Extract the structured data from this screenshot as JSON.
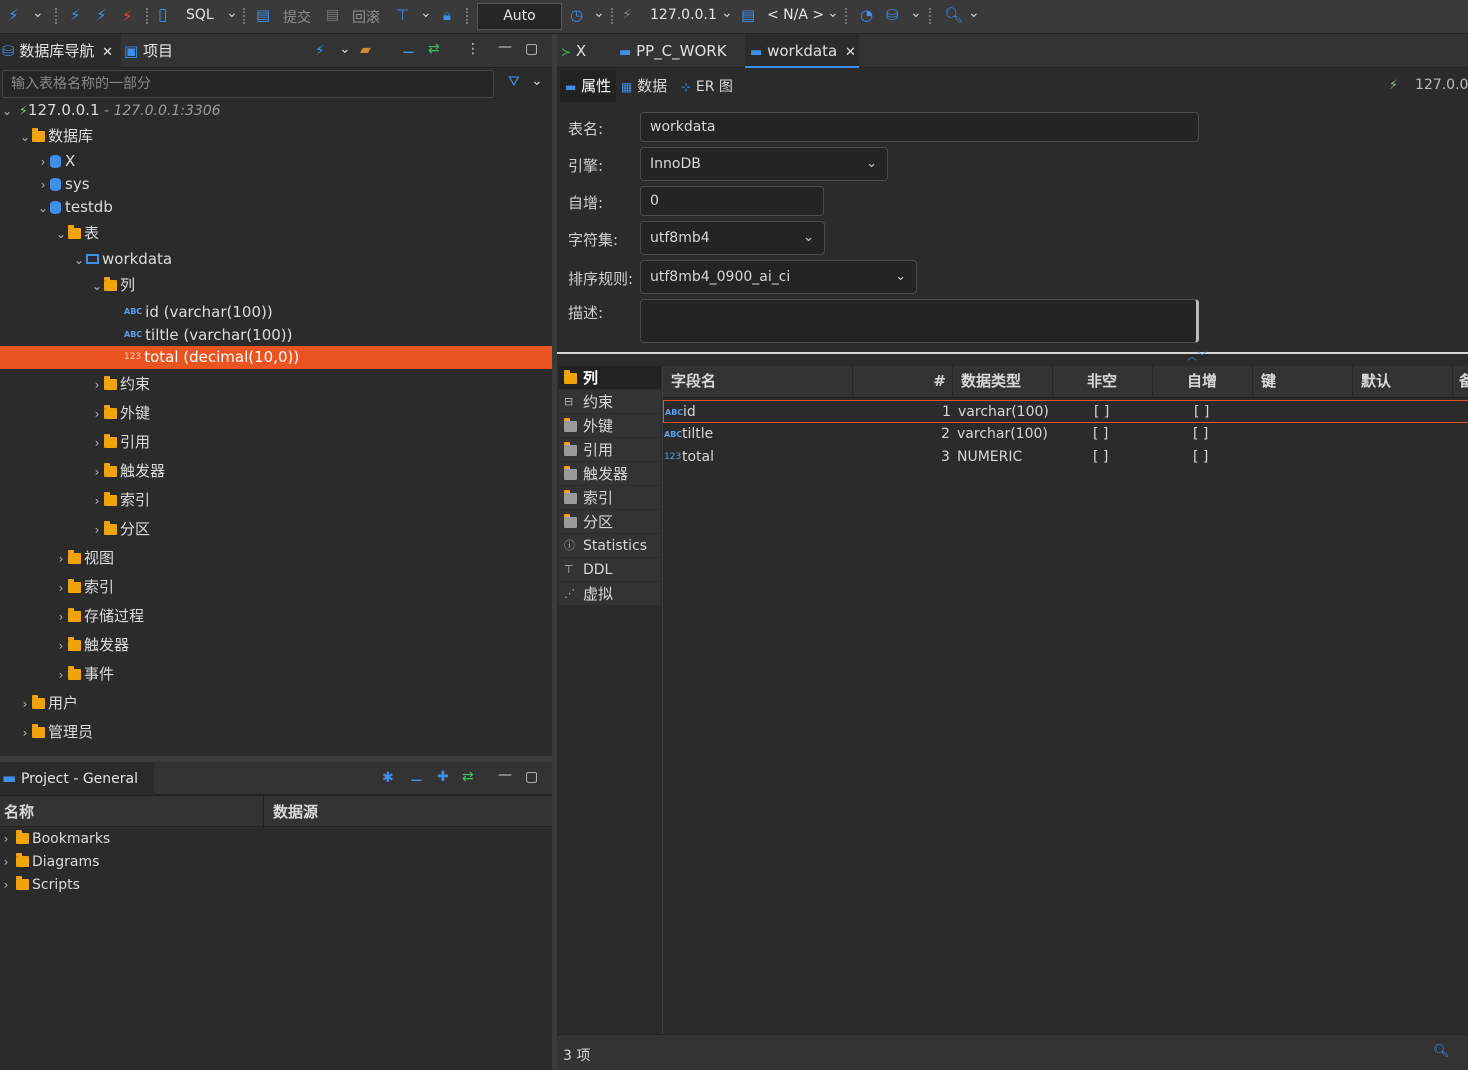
{
  "toolbar": {
    "sql_label": "SQL",
    "commit_label": "提交",
    "rollback_label": "回滚",
    "auto_label": "Auto",
    "host_label": "127.0.0.1",
    "schema_label": "< N/A >"
  },
  "navigator": {
    "tab_label": "数据库导航",
    "projects_tab_label": "项目",
    "filter_placeholder": "输入表格名称的一部分",
    "connection": {
      "name": "127.0.0.1",
      "detail": " - 127.0.0.1:3306"
    },
    "databases_label": "数据库",
    "db_x": "X",
    "db_sys": "sys",
    "db_testdb": "testdb",
    "tables_label": "表",
    "table_workdata": "workdata",
    "columns_label": "列",
    "columns": [
      "id (varchar(100))",
      "tiltle (varchar(100))",
      "total (decimal(10,0))"
    ],
    "table_children": [
      "约束",
      "外键",
      "引用",
      "触发器",
      "索引",
      "分区"
    ],
    "db_children": [
      "视图",
      "索引",
      "存储过程",
      "触发器",
      "事件"
    ],
    "users_label": "用户",
    "admin_label": "管理员"
  },
  "project": {
    "tab_label": "Project - General",
    "col_name": "名称",
    "col_source": "数据源",
    "items": [
      "Bookmarks",
      "Diagrams",
      "Scripts"
    ]
  },
  "editor": {
    "tabs": [
      "X",
      "PP_C_WORK",
      "workdata"
    ],
    "subtabs": [
      "属性",
      "数据",
      "ER 图"
    ],
    "conn_label": "127.0.0.",
    "props": {
      "table_name_label": "表名:",
      "table_name": "workdata",
      "engine_label": "引擎:",
      "engine": "InnoDB",
      "autoinc_label": "自增:",
      "autoinc": "0",
      "charset_label": "字符集:",
      "charset": "utf8mb4",
      "collation_label": "排序规则:",
      "collation": "utf8mb4_0900_ai_ci",
      "desc_label": "描述:"
    },
    "side_items": [
      "列",
      "约束",
      "外键",
      "引用",
      "触发器",
      "索引",
      "分区",
      "Statistics",
      "DDL",
      "虚拟"
    ],
    "grid_headers": [
      "字段名",
      "#",
      "数据类型",
      "非空",
      "自增",
      "键",
      "默认",
      "备"
    ],
    "rows": [
      {
        "name": "id",
        "num": "1",
        "type": "varchar(100)",
        "notnull": "[ ]",
        "autoinc": "[ ]"
      },
      {
        "name": "tiltle",
        "num": "2",
        "type": "varchar(100)",
        "notnull": "[ ]",
        "autoinc": "[ ]"
      },
      {
        "name": "total",
        "num": "3",
        "type": "NUMERIC",
        "notnull": "[ ]",
        "autoinc": "[ ]"
      }
    ],
    "status_count": "3 项"
  },
  "colors": {
    "accent": "#e95420",
    "blue": "#3f8ee8",
    "folder": "#f0a30a"
  }
}
